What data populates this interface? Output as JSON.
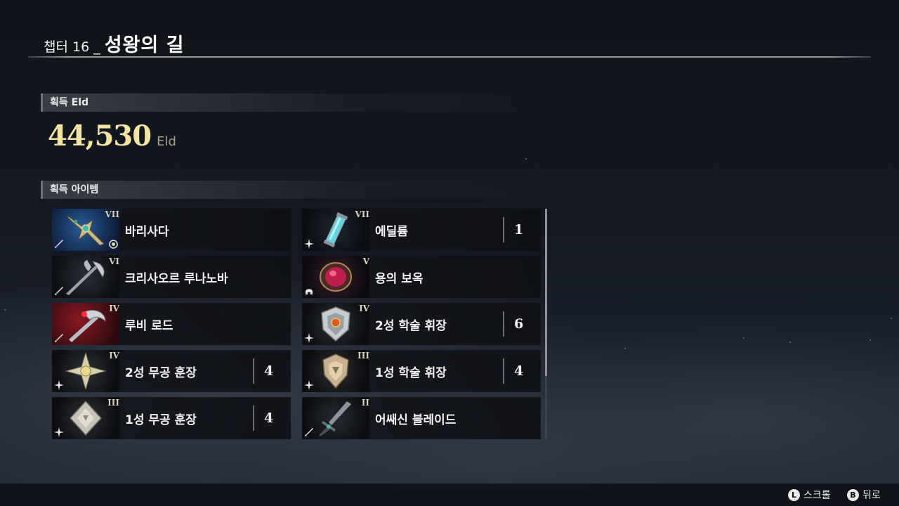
{
  "header": {
    "chapter_prefix": "챕터 16 _",
    "chapter_title": "성왕의 길"
  },
  "eld_section": {
    "label": "획득 Eld",
    "value": "44,530",
    "unit": "Eld"
  },
  "items_section": {
    "label": "획득 아이템",
    "items": [
      {
        "name": "바리사다",
        "grade": "VII",
        "quantity": "",
        "type_icon": "sword-icon",
        "art": "ornate-staff",
        "badge": "equipped-icon"
      },
      {
        "name": "에딜륨",
        "grade": "VII",
        "quantity": "1",
        "type_icon": "sparkle-icon",
        "art": "crystal-vial"
      },
      {
        "name": "크리사오르 루나노바",
        "grade": "VI",
        "quantity": "",
        "type_icon": "sword-icon",
        "art": "lance"
      },
      {
        "name": "용의 보옥",
        "grade": "V",
        "quantity": "",
        "type_icon": "helmet-icon",
        "art": "red-gem"
      },
      {
        "name": "루비 로드",
        "grade": "IV",
        "quantity": "",
        "type_icon": "sword-icon",
        "art": "ruby-rod"
      },
      {
        "name": "2성 학술 휘장",
        "grade": "IV",
        "quantity": "6",
        "type_icon": "sparkle-icon",
        "art": "shield-emblem"
      },
      {
        "name": "2성 무공 훈장",
        "grade": "IV",
        "quantity": "4",
        "type_icon": "sparkle-icon",
        "art": "star-medal"
      },
      {
        "name": "1성 학술 휘장",
        "grade": "III",
        "quantity": "4",
        "type_icon": "sparkle-icon",
        "art": "bronze-shield"
      },
      {
        "name": "1성 무공 훈장",
        "grade": "III",
        "quantity": "4",
        "type_icon": "sparkle-icon",
        "art": "silver-medal"
      },
      {
        "name": "어쌔신 블레이드",
        "grade": "II",
        "quantity": "",
        "type_icon": "sword-icon",
        "art": "blade"
      }
    ]
  },
  "footer": {
    "scroll_button": "L",
    "scroll_label": "스크롤",
    "back_button": "B",
    "back_label": "뒤로"
  },
  "colors": {
    "eld_value": "#f4e3a2",
    "accent_line": "#9a9a9e"
  }
}
